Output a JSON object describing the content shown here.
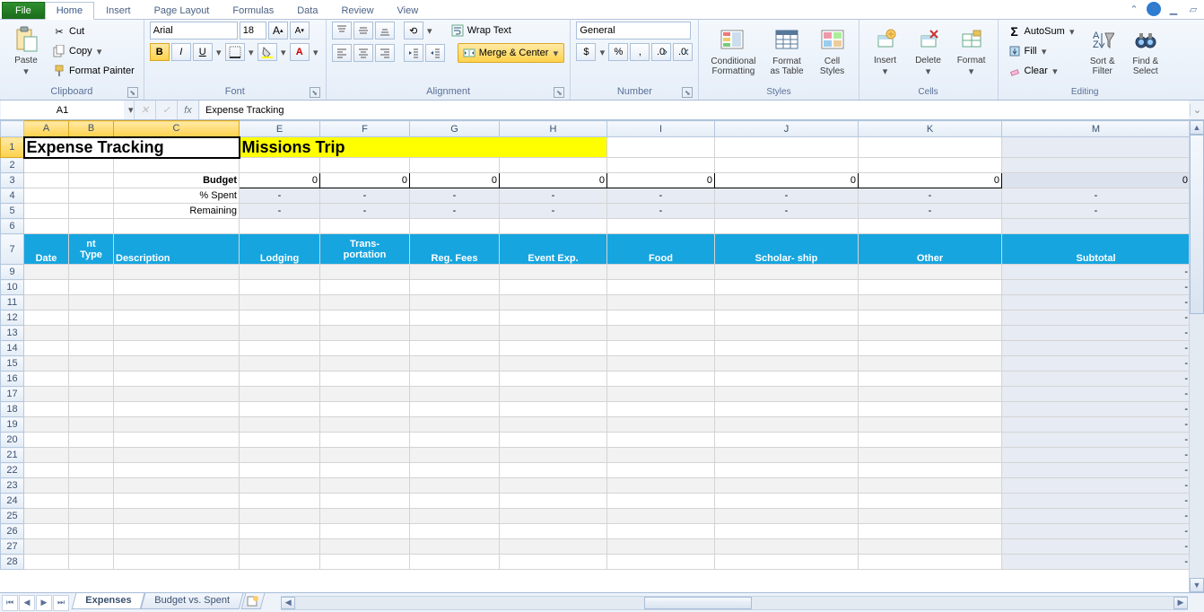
{
  "tabs": {
    "file": "File",
    "home": "Home",
    "insert": "Insert",
    "pagelayout": "Page Layout",
    "formulas": "Formulas",
    "data": "Data",
    "review": "Review",
    "view": "View"
  },
  "ribbon": {
    "clipboard": {
      "paste": "Paste",
      "cut": "Cut",
      "copy": "Copy",
      "fmtpainter": "Format Painter",
      "title": "Clipboard"
    },
    "font": {
      "name": "Arial",
      "size": "18",
      "bold": "B",
      "italic": "I",
      "underline": "U",
      "title": "Font"
    },
    "alignment": {
      "wrap": "Wrap Text",
      "merge": "Merge & Center",
      "title": "Alignment"
    },
    "number": {
      "format": "General",
      "title": "Number"
    },
    "styles": {
      "cond": "Conditional\nFormatting",
      "table": "Format\nas Table",
      "cell": "Cell\nStyles",
      "title": "Styles"
    },
    "cells": {
      "insert": "Insert",
      "delete": "Delete",
      "format": "Format",
      "title": "Cells"
    },
    "editing": {
      "autosum": "AutoSum",
      "fill": "Fill",
      "clear": "Clear",
      "sort": "Sort &\nFilter",
      "find": "Find &\nSelect",
      "title": "Editing"
    }
  },
  "namebox": "A1",
  "formula": "Expense Tracking",
  "cols": {
    "A": "A",
    "B": "B",
    "C": "C",
    "E": "E",
    "F": "F",
    "G": "G",
    "H": "H",
    "I": "I",
    "J": "J",
    "K": "K",
    "M": "M"
  },
  "cells": {
    "title": "Expense Tracking",
    "subtitle": "Missions Trip",
    "budget": "Budget",
    "pctspent": "% Spent",
    "remaining": "Remaining",
    "zero": "0",
    "dash": "-",
    "hdr": {
      "date": "Date",
      "nt": "nt",
      "type": "Type",
      "desc": "Description",
      "lodging": "Lodging",
      "trans1": "Trans-",
      "trans2": "portation",
      "regfees": "Reg. Fees",
      "eventexp": "Event Exp.",
      "food": "Food",
      "scholar": "Scholar- ship",
      "other": "Other",
      "subtotal": "Subtotal"
    }
  },
  "sheettabs": {
    "expenses": "Expenses",
    "budget": "Budget vs. Spent"
  }
}
